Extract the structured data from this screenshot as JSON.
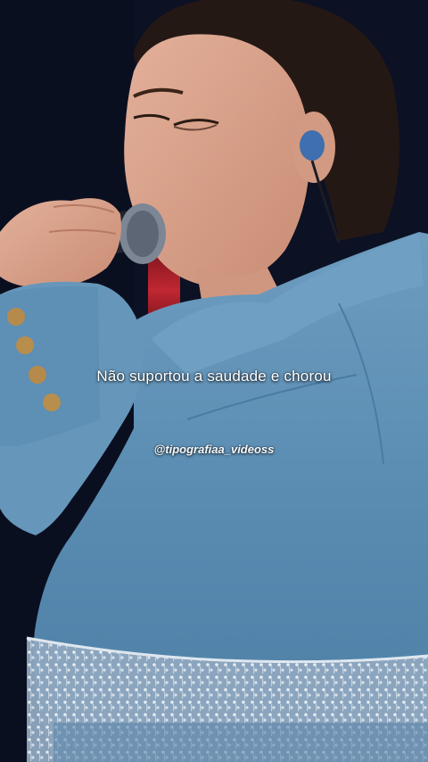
{
  "overlay": {
    "caption": "Não suportou a saudade e chorou",
    "handle": "@tipografiaa_videoss"
  },
  "colors": {
    "background": "#0b0f22",
    "denim": "#5f8fb3",
    "skin": "#d9a48c",
    "hair": "#241815",
    "stage_red": "#c4212b",
    "text": "#ffffff"
  }
}
